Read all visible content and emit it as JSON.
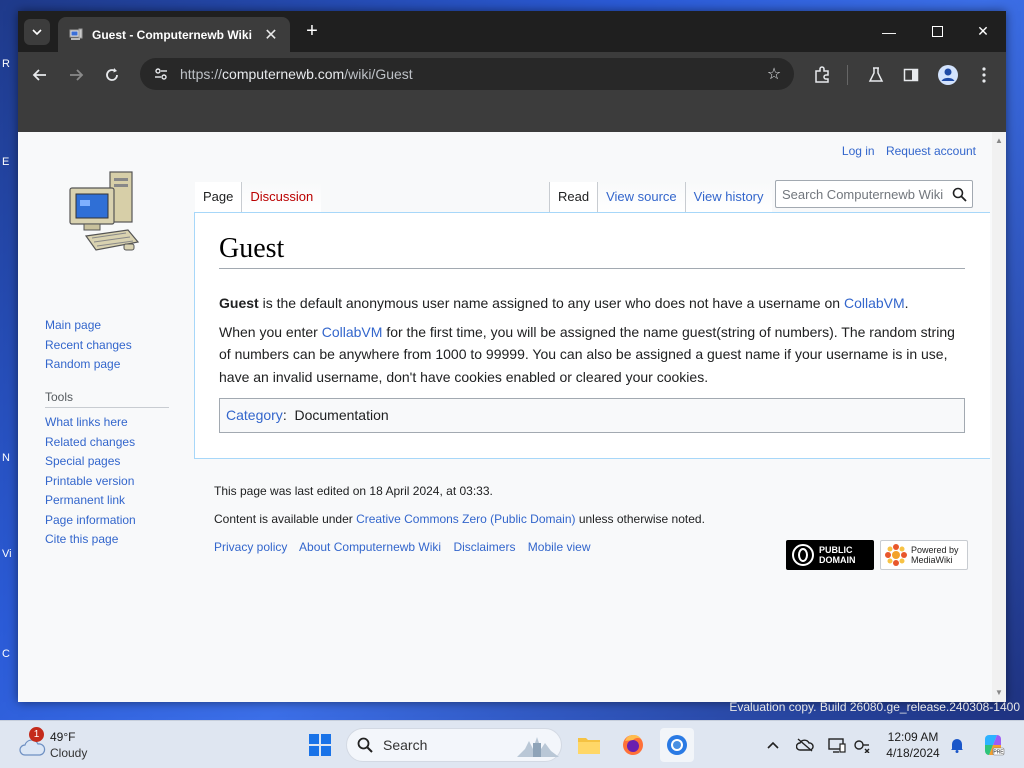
{
  "desktop": {
    "edge_letters": [
      "R",
      "E",
      "N",
      "Vi",
      "C"
    ]
  },
  "browser": {
    "tab_title": "Guest - Computernewb Wiki",
    "url_scheme": "https://",
    "url_host": "computernewb.com",
    "url_path": "/wiki/Guest"
  },
  "wiki": {
    "personal": {
      "login": "Log in",
      "request": "Request account"
    },
    "nav_links": [
      "Main page",
      "Recent changes",
      "Random page"
    ],
    "tools_heading": "Tools",
    "tools_links": [
      "What links here",
      "Related changes",
      "Special pages",
      "Printable version",
      "Permanent link",
      "Page information",
      "Cite this page"
    ],
    "tabs_left": {
      "page": "Page",
      "discussion": "Discussion"
    },
    "tabs_right": {
      "read": "Read",
      "view_source": "View source",
      "view_history": "View history"
    },
    "search_placeholder": "Search Computernewb Wiki",
    "title": "Guest",
    "p1": {
      "bold": "Guest",
      "text": " is the default anonymous user name assigned to any user who does not have a username on ",
      "link": "CollabVM",
      "end": "."
    },
    "p2": {
      "start": "When you enter ",
      "link": "CollabVM",
      "text": " for the first time, you will be assigned the name guest(string of numbers). The random string of numbers can be anywhere from 1000 to 99999. You can also be assigned a guest name if your username is in use, have an invalid username, don't have cookies enabled or cleared your cookies."
    },
    "category_label": "Category",
    "category_sep": ":",
    "category_value": "Documentation",
    "footer": {
      "last_edited": "This page was last edited on 18 April 2024, at 03:33.",
      "license_pre": "Content is available under ",
      "license_link": "Creative Commons Zero (Public Domain)",
      "license_post": " unless otherwise noted.",
      "places": [
        "Privacy policy",
        "About Computernewb Wiki",
        "Disclaimers",
        "Mobile view"
      ],
      "badge_pd_line1": "PUBLIC",
      "badge_pd_line2": "DOMAIN",
      "badge_mw_line1": "Powered by",
      "badge_mw_line2": "MediaWiki"
    }
  },
  "watermark": "Evaluation copy. Build 26080.ge_release.240308-1400",
  "taskbar": {
    "weather_temp": "49°F",
    "weather_cond": "Cloudy",
    "weather_badge": "1",
    "search_label": "Search",
    "time": "12:09 AM",
    "date": "4/18/2024"
  },
  "colors": {
    "link": "#3366cc",
    "redlink": "#ba0000",
    "chrome_dark": "#1f1f1f",
    "chrome_toolbar": "#3c3c3c"
  }
}
